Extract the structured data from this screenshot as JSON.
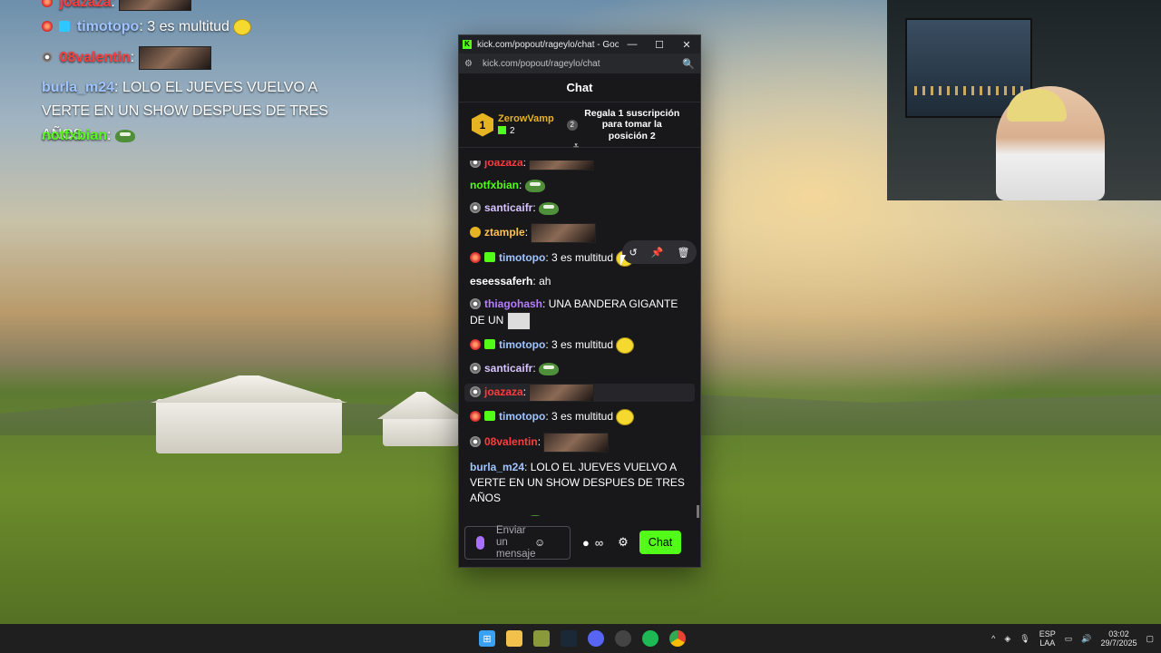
{
  "overlay_chat": [
    {
      "user": "joazaza",
      "text": "",
      "emote": "thumbnail"
    },
    {
      "user": "timotopo",
      "text": "3 es multitud",
      "emote": "yellow-emote"
    },
    {
      "user": "08valentin",
      "text": "",
      "emote": "thumbnail"
    },
    {
      "user": "burla_m24",
      "text": "LOLO EL JUEVES VUELVO A VERTE EN UN SHOW DESPUES DE TRES AÑOS"
    },
    {
      "user": "notfxbian",
      "text": "",
      "emote": "pepe"
    }
  ],
  "window": {
    "title": "kick.com/popout/rageylo/chat - Google Ch...",
    "url": "kick.com/popout/rageylo/chat",
    "controls": {
      "minimize": "—",
      "maximize": "☐",
      "close": "✕"
    }
  },
  "chat": {
    "header": "Chat",
    "top_gifter": {
      "rank": "1",
      "name": "ZerowVamp",
      "count": "2"
    },
    "slot2": {
      "rank": "2",
      "text": "Regala 1 suscripción para tomar la posición 2"
    },
    "messages": [
      {
        "user": "joazaza",
        "color": "#ff3b3b",
        "badge": "gray",
        "text": "",
        "emote": "thumbnail"
      },
      {
        "user": "notfxbian",
        "color": "#53fc18",
        "badge": "",
        "text": "",
        "emote": "pepe"
      },
      {
        "user": "santicaifr",
        "color": "#d7c3ff",
        "badge": "gray",
        "text": "",
        "emote": "pepe"
      },
      {
        "user": "ztample",
        "color": "#ffc14d",
        "badge": "crown",
        "text": "",
        "emote": "thumbnail"
      },
      {
        "user": "timotopo",
        "color": "#a0c4ff",
        "badge": "red+gift",
        "text": "3 es multitud",
        "emote": "yellow-emote"
      },
      {
        "user": "eseessaferh",
        "color": "#ffffff",
        "badge": "",
        "text": "ah"
      },
      {
        "user": "thiagohash",
        "color": "#b57dff",
        "badge": "gray",
        "text": "UNA BANDERA GIGANTE DE UN",
        "emote": "sticker"
      },
      {
        "user": "timotopo",
        "color": "#a0c4ff",
        "badge": "red+gift",
        "text": "3 es multitud",
        "emote": "yellow-emote"
      },
      {
        "user": "santicaifr",
        "color": "#d7c3ff",
        "badge": "gray",
        "text": "",
        "emote": "pepe"
      },
      {
        "user": "joazaza",
        "color": "#ff3b3b",
        "badge": "gray",
        "text": "",
        "emote": "thumbnail"
      },
      {
        "user": "timotopo",
        "color": "#a0c4ff",
        "badge": "red+gift",
        "text": "3 es multitud",
        "emote": "yellow-emote"
      },
      {
        "user": "08valentin",
        "color": "#ff3b3b",
        "badge": "gray",
        "text": "",
        "emote": "thumbnail"
      },
      {
        "user": "burla_m24",
        "color": "#a0c4ff",
        "badge": "",
        "text": "LOLO EL JUEVES VUELVO A VERTE EN UN SHOW DESPUES DE TRES AÑOS"
      },
      {
        "user": "notfxbian",
        "color": "#53fc18",
        "badge": "",
        "text": "",
        "emote": "pepe"
      }
    ],
    "composer": {
      "placeholder": "Enviar un mensaje",
      "send_label": "Chat"
    }
  },
  "taskbar": {
    "lang": "ESP",
    "lang2": "LAA",
    "time": "03:02",
    "date": "29/7/2025"
  }
}
